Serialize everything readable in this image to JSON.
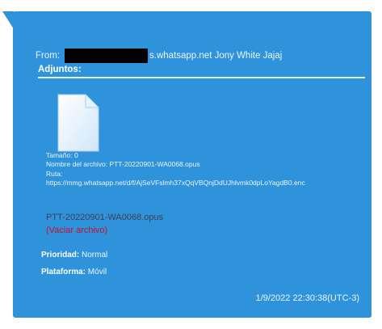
{
  "message": {
    "from_label": "From:",
    "from_suffix": "s.whatsapp.net Jony White Jajaj",
    "attachments_title": "Adjuntos:",
    "attachment": {
      "icon": "document-file-icon",
      "size_line": "Tamaño: 0",
      "name_line": "Nombre del archivo: PTT-20220901-WA0068.opus",
      "ruta_label": "Ruta:",
      "url": "https://mmg.whatsapp.net/d/f/AjSeVFslmh37xQqVBQnjDdUJhlvmk0dpLoYagdB0.enc",
      "file_link": "PTT-20220901-WA0068.opus",
      "clear_link": "(Vaciar archivo)"
    },
    "properties": {
      "priority_label": "Prioridad:",
      "priority_value": "Normal",
      "platform_label": "Plataforma:",
      "platform_value": "Móvil"
    },
    "timestamp": "1/9/2022 22:30:38(UTC-3)"
  },
  "colors": {
    "bubble": "#2f93dc",
    "text": "#eaf4fd",
    "link": "#3f3f52",
    "clear_link": "#c4122c"
  }
}
